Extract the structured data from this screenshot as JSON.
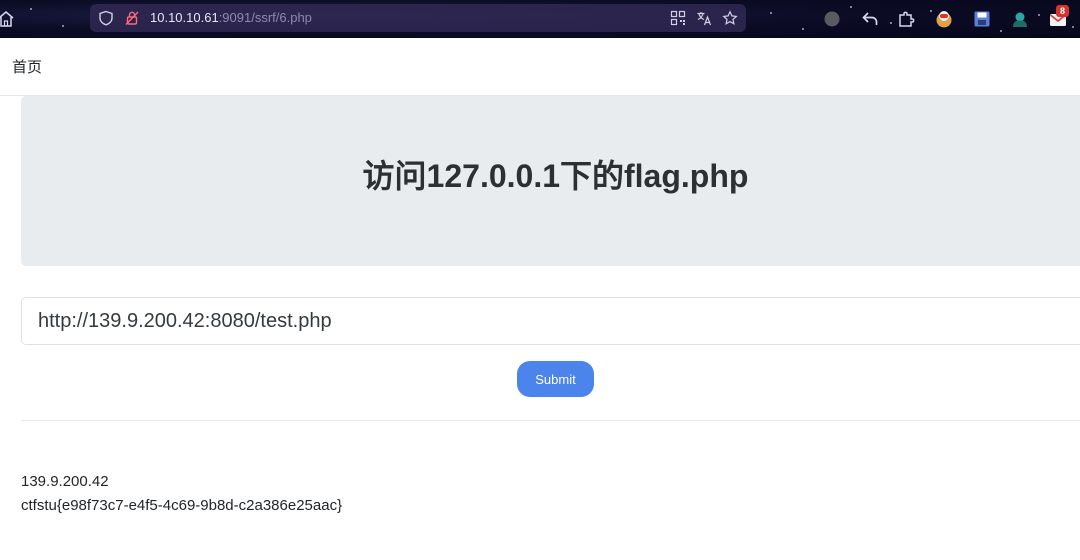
{
  "browser": {
    "url_host": "10.10.10.61",
    "url_path": ":9091/ssrf/6.php",
    "notification_count": "8"
  },
  "nav": {
    "home_label": "首页"
  },
  "hero": {
    "title": "访问127.0.0.1下的flag.php"
  },
  "form": {
    "url_value": "http://139.9.200.42:8080/test.php",
    "submit_label": "Submit"
  },
  "result": {
    "ip": "139.9.200.42",
    "flag": "ctfstu{e98f73c7-e4f5-4c69-9b8d-c2a386e25aac}"
  },
  "icons": {
    "home": "home-icon",
    "shield": "shield-icon",
    "insecure": "insecure-lock-icon",
    "qr": "qr-code-icon",
    "translate": "translate-icon",
    "bookmark": "star-bookmark-icon",
    "profile": "profile-dot-icon",
    "back": "undo-arrow-icon",
    "extensions": "puzzle-icon",
    "cookie": "cookie-extension-icon",
    "save": "save-icon",
    "hacker": "hacker-extension-icon",
    "mail": "mail-extension-icon"
  },
  "colors": {
    "accent": "#4b84ea",
    "hero_bg": "#e9ecef",
    "browser_bg": "#0c0d26"
  }
}
